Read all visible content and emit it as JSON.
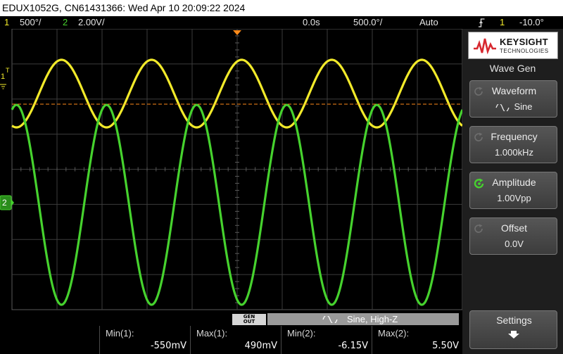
{
  "title": "EDUX1052G, CN61431366: Wed Apr 10 20:09:22 2024",
  "status_bar": {
    "ch1_num": "1",
    "ch1_scale": "500°/",
    "ch2_num": "2",
    "ch2_scale": "2.00V/",
    "time_delay": "0.0s",
    "time_scale": "500.0°/",
    "trigger_mode": "Auto",
    "trigger_src": "1",
    "trigger_level": "-10.0°"
  },
  "markers": {
    "ch1": "1",
    "ch1_trig": "T",
    "ch2": "2"
  },
  "gen_bar": {
    "out_line1": "GEN",
    "out_line2": "OUT",
    "info": "Sine, High-Z"
  },
  "measurements": [
    {
      "label": "Min(1):",
      "value": "-550mV"
    },
    {
      "label": "Max(1):",
      "value": "490mV"
    },
    {
      "label": "Min(2):",
      "value": "-6.15V"
    },
    {
      "label": "Max(2):",
      "value": "5.50V"
    }
  ],
  "side_panel": {
    "logo_name": "KEYSIGHT",
    "logo_sub": "TECHNOLOGIES",
    "menu_title": "Wave Gen",
    "waveform_label": "Waveform",
    "waveform_value": "Sine",
    "frequency_label": "Frequency",
    "frequency_value": "1.000kHz",
    "amplitude_label": "Amplitude",
    "amplitude_value": "1.00Vpp",
    "offset_label": "Offset",
    "offset_value": "0.0V",
    "settings_label": "Settings"
  },
  "colors": {
    "ch1": "#f2ea2a",
    "ch2": "#46d22e",
    "trigger": "#ff8a1a",
    "logo_red": "#d7282f"
  },
  "icons": {
    "trigger_edge": "rising-edge-icon",
    "sine": "sine-wave-icon",
    "knob": "rotary-knob-icon",
    "settings": "arrow-down-icon"
  }
}
